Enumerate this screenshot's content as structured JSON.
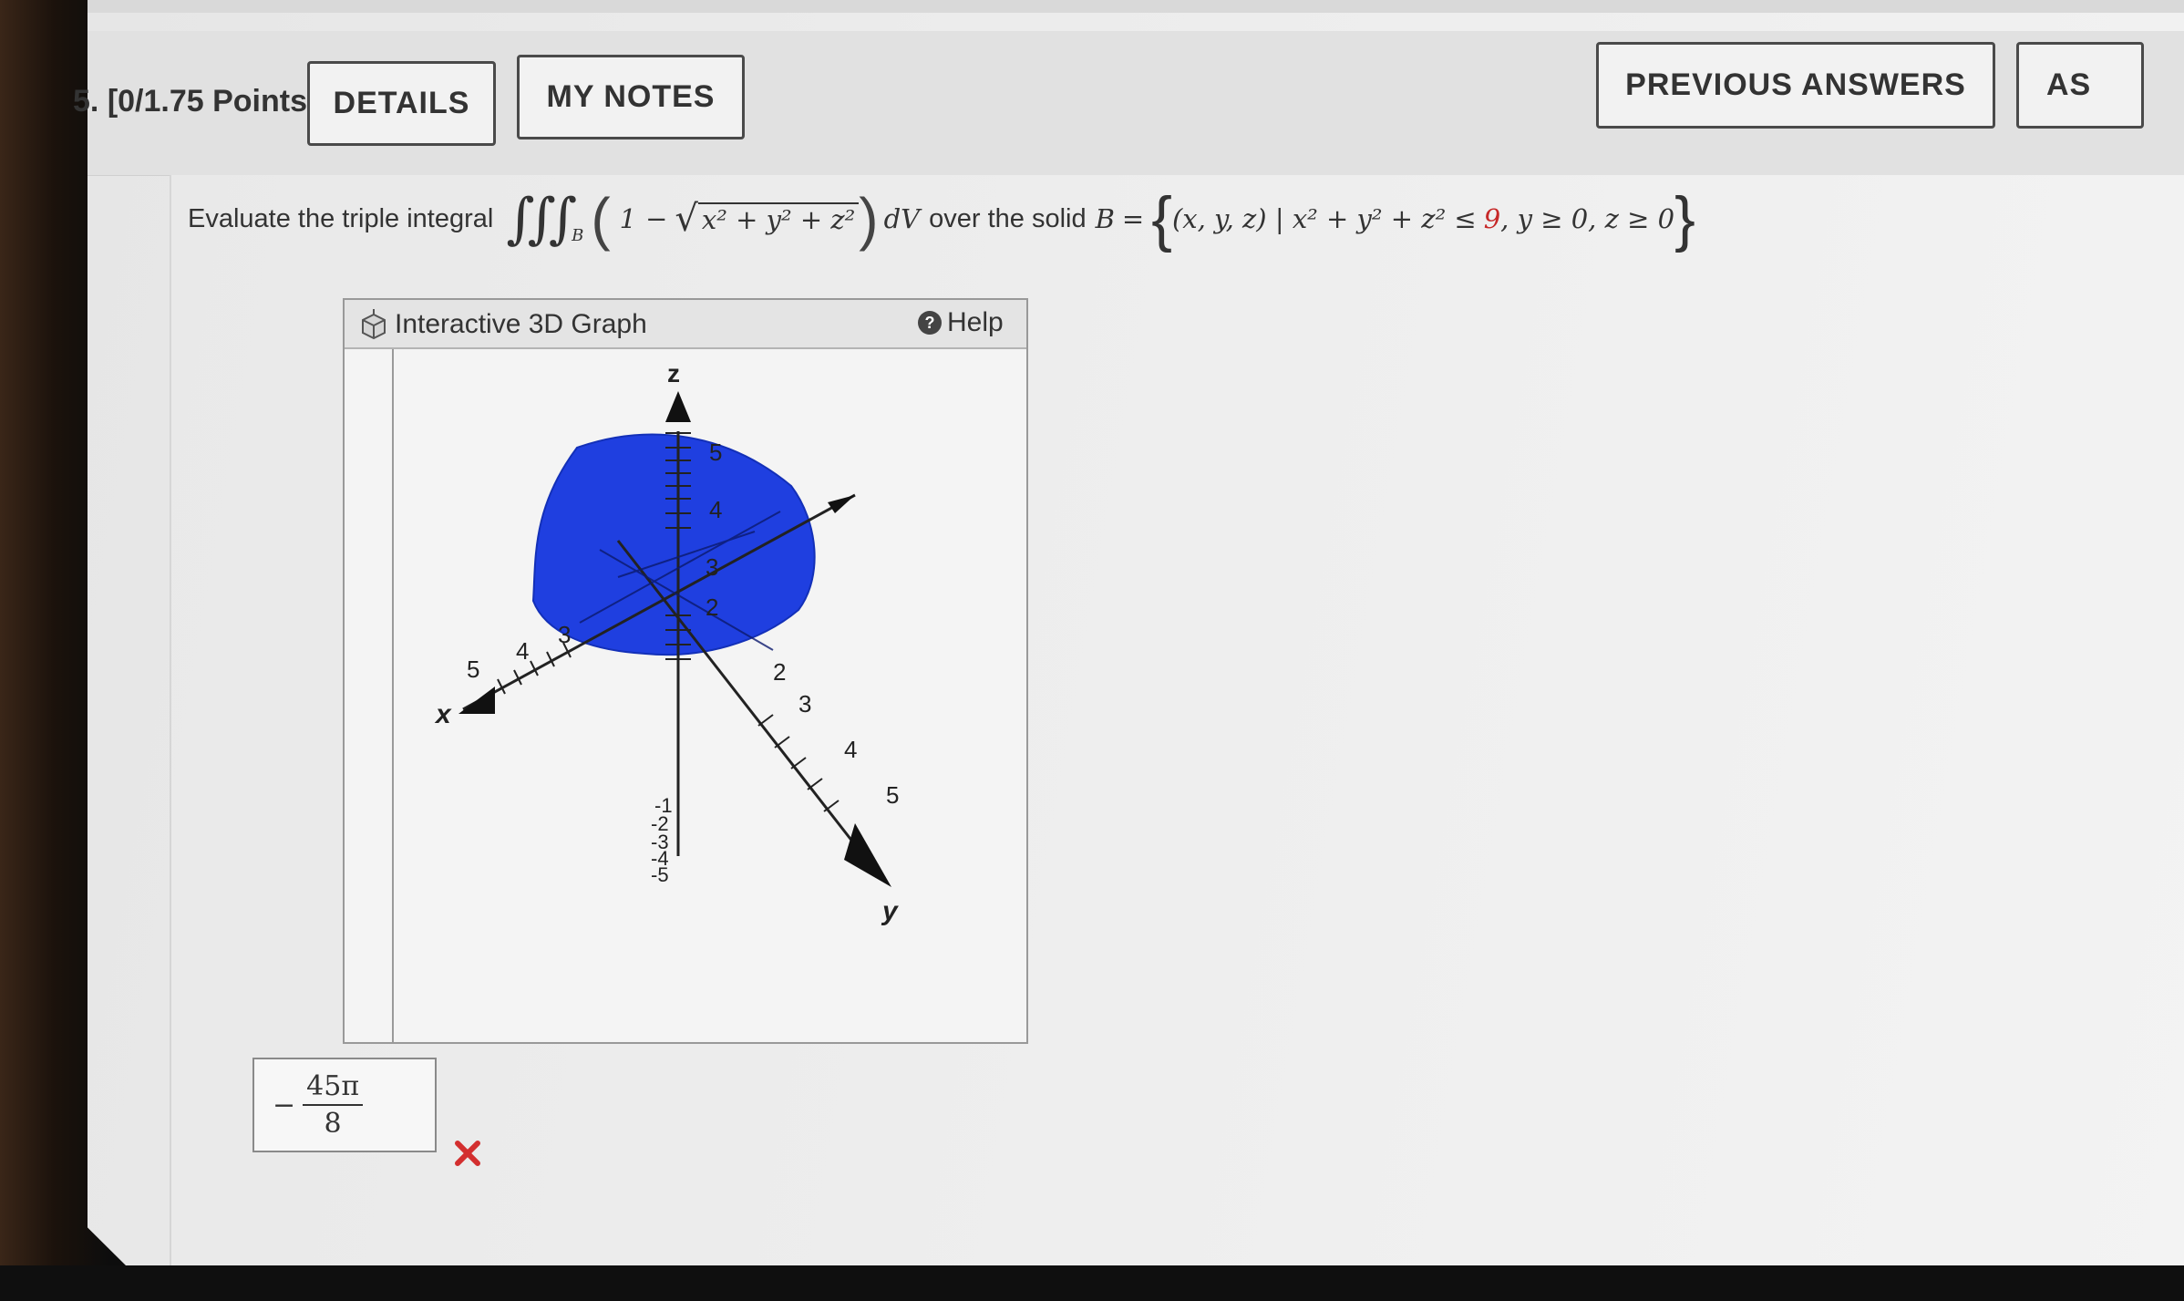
{
  "question": {
    "number_label": "5.",
    "points_label": "[0/1.75 Points]",
    "buttons": {
      "details": "DETAILS",
      "my_notes": "MY NOTES",
      "previous_answers": "PREVIOUS ANSWERS",
      "ask": "AS"
    },
    "prompt_prefix": "Evaluate the triple integral",
    "integrand_one": "1",
    "radicand": "x² + y² + z²",
    "dv": "dV",
    "over_text": "over the solid",
    "solid_name": "B",
    "region_domain": "(x, y, z) | x² + y² + z² ≤",
    "radius_sq": "9",
    "region_conditions": ", y ≥ 0, z ≥ 0",
    "integral_subscript": "B"
  },
  "graph": {
    "title": "Interactive 3D Graph",
    "help_label": "Help",
    "axis_labels": {
      "x": "x",
      "y": "y",
      "z": "z"
    },
    "z_ticks": [
      "5",
      "4",
      "3",
      "2"
    ],
    "y_ticks": [
      "2",
      "3",
      "4",
      "5"
    ],
    "x_ticks": [
      "3",
      "4",
      "5"
    ],
    "neg_z_ticks": [
      "-1",
      "-2",
      "-3",
      "-4",
      "-5"
    ],
    "solid_color": "#1f3fe0"
  },
  "answer": {
    "sign": "−",
    "numerator": "45π",
    "denominator": "8",
    "status_icon": "wrong-x-icon",
    "status_color": "#d32f2f"
  }
}
